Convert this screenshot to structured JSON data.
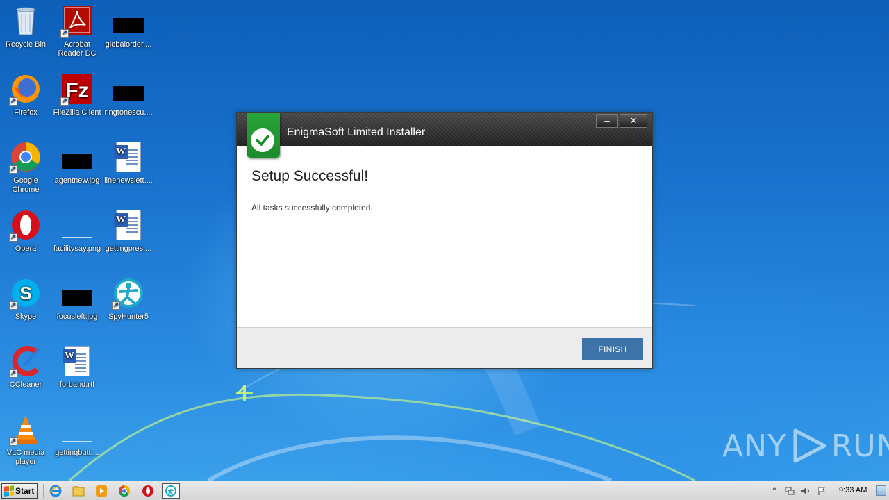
{
  "desktop": {
    "icons": [
      {
        "label": "Recycle Bin"
      },
      {
        "label": "Acrobat Reader DC"
      },
      {
        "label": "globalorder...."
      },
      {
        "label": "Firefox"
      },
      {
        "label": "FileZilla Client"
      },
      {
        "label": "ringtonescu...."
      },
      {
        "label": "Google Chrome"
      },
      {
        "label": "agentnew.jpg"
      },
      {
        "label": "linenewslett...."
      },
      {
        "label": "Opera"
      },
      {
        "label": "facilitysay.png"
      },
      {
        "label": "gettingpres...."
      },
      {
        "label": "Skype"
      },
      {
        "label": "focusleft.jpg"
      },
      {
        "label": "SpyHunter5"
      },
      {
        "label": "CCleaner"
      },
      {
        "label": "forband.rtf"
      },
      {
        "label": "VLC media player"
      },
      {
        "label": "gettingbutt...."
      }
    ]
  },
  "installer": {
    "title": "EnigmaSoft Limited Installer",
    "minimize_label": "–",
    "close_label": "✕",
    "headline": "Setup Successful!",
    "message": "All tasks successfully completed.",
    "finish_label": "FINISH",
    "accent_color": "#3d73a8",
    "logo_color": "#27a53a"
  },
  "watermark": {
    "left": "ANY",
    "right": "RUN"
  },
  "taskbar": {
    "start_label": "Start",
    "clock": "9:33 AM",
    "pinned": [
      "internet-explorer",
      "file-explorer",
      "media-player",
      "chrome",
      "opera",
      "spyhunter"
    ]
  }
}
